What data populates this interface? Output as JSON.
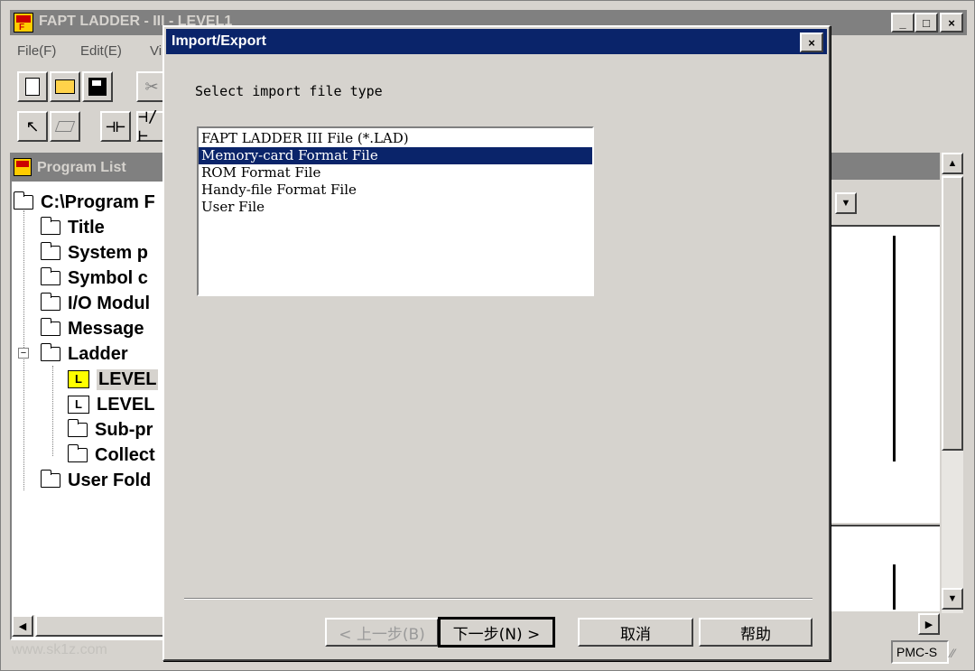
{
  "main_window": {
    "title": "FAPT LADDER - III - LEVEL1",
    "menu": [
      "File(F)",
      "Edit(E)",
      "Vi"
    ],
    "caption_buttons": [
      "_",
      "□",
      "×"
    ]
  },
  "program_list": {
    "title": "Program List",
    "root": "C:\\Program F",
    "items": [
      {
        "label": "Title",
        "type": "folder"
      },
      {
        "label": "System p",
        "type": "folder"
      },
      {
        "label": "Symbol c",
        "type": "folder"
      },
      {
        "label": "I/O Modul",
        "type": "folder"
      },
      {
        "label": "Message",
        "type": "folder"
      },
      {
        "label": "Ladder",
        "type": "folder"
      },
      {
        "label": "LEVEL",
        "type": "ladder-highlighted"
      },
      {
        "label": "LEVEL",
        "type": "ladder"
      },
      {
        "label": "Sub-pr",
        "type": "folder"
      },
      {
        "label": "Collect",
        "type": "folder"
      },
      {
        "label": "User Fold",
        "type": "folder"
      }
    ],
    "expander": "−"
  },
  "statusbar": {
    "watermark": "www.sk1z.com",
    "panel": "PMC-S"
  },
  "dialog": {
    "title": "Import/Export",
    "close_glyph": "×",
    "prompt": "Select import file type",
    "file_types": [
      "FAPT LADDER III File (*.LAD)",
      "Memory-card Format File",
      "ROM Format File",
      "Handy-file Format File",
      "User File"
    ],
    "selected_index": 1,
    "buttons": {
      "back": "< 上一步(B)",
      "next": "下一步(N) >",
      "cancel": "取消",
      "help": "帮助"
    }
  },
  "colors": {
    "face": "#d6d3ce",
    "active_title": "#0a246a",
    "inactive_title": "#808080",
    "selection": "#0a246a"
  }
}
